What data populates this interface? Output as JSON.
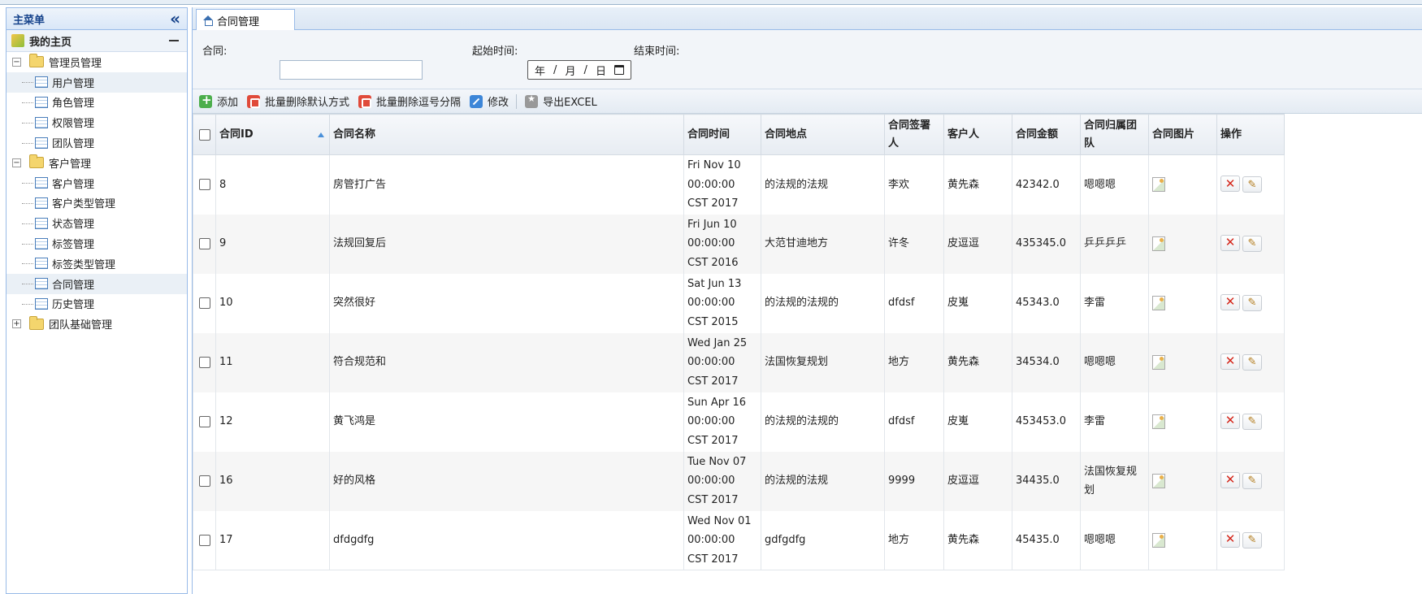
{
  "left_panel": {
    "title": "主菜单",
    "home_label": "我的主页",
    "tree": [
      {
        "label": "管理员管理",
        "expander": "−",
        "children": [
          "用户管理",
          "角色管理",
          "权限管理",
          "团队管理"
        ]
      },
      {
        "label": "客户管理",
        "expander": "−",
        "children": [
          "客户管理",
          "客户类型管理",
          "状态管理",
          "标签管理",
          "标签类型管理",
          "合同管理",
          "历史管理"
        ]
      },
      {
        "label": "团队基础管理",
        "expander": "+",
        "children": []
      }
    ]
  },
  "tab": {
    "label": "合同管理"
  },
  "search": {
    "contract_label": "合同:",
    "contract_value": "",
    "start_label": "起始时间:",
    "date_placeholder": {
      "year": "年",
      "month": "月",
      "day": "日"
    },
    "end_label": "结束时间:"
  },
  "toolbar": {
    "add": "添加",
    "batch_delete_default": "批量删除默认方式",
    "batch_delete_comma": "批量删除逗号分隔",
    "modify": "修改",
    "export": "导出EXCEL"
  },
  "grid": {
    "headers": [
      "合同ID",
      "合同名称",
      "合同时间",
      "合同地点",
      "合同签署人",
      "客户人",
      "合同金额",
      "合同归属团队",
      "合同图片",
      "操作"
    ],
    "rows": [
      {
        "id": "8",
        "name": "房管打广告",
        "time": "Fri Nov 10 00:00:00 CST 2017",
        "place": "的法规的法规",
        "signer": "李欢",
        "customer": "黄先森",
        "amount": "42342.0",
        "team": "嗯嗯嗯"
      },
      {
        "id": "9",
        "name": "法规回复后",
        "time": "Fri Jun 10 00:00:00 CST 2016",
        "place": "大范甘迪地方",
        "signer": "许冬",
        "customer": "皮逗逗",
        "amount": "435345.0",
        "team": "乒乒乒乒"
      },
      {
        "id": "10",
        "name": "突然很好",
        "time": "Sat Jun 13 00:00:00 CST 2015",
        "place": "的法规的法规的",
        "signer": "dfdsf",
        "customer": "皮嵬",
        "amount": "45343.0",
        "team": "李雷"
      },
      {
        "id": "11",
        "name": "符合规范和",
        "time": "Wed Jan 25 00:00:00 CST 2017",
        "place": "法国恢复规划",
        "signer": "地方",
        "customer": "黄先森",
        "amount": "34534.0",
        "team": "嗯嗯嗯"
      },
      {
        "id": "12",
        "name": "黄飞鸿是",
        "time": "Sun Apr 16 00:00:00 CST 2017",
        "place": "的法规的法规的",
        "signer": "dfdsf",
        "customer": "皮嵬",
        "amount": "453453.0",
        "team": "李雷"
      },
      {
        "id": "16",
        "name": "好的风格",
        "time": "Tue Nov 07 00:00:00 CST 2017",
        "place": "的法规的法规",
        "signer": "9999",
        "customer": "皮逗逗",
        "amount": "34435.0",
        "team": "法国恢复规划"
      },
      {
        "id": "17",
        "name": "dfdgdfg",
        "time": "Wed Nov 01 00:00:00 CST 2017",
        "place": "gdfgdfg",
        "signer": "地方",
        "customer": "黄先森",
        "amount": "45435.0",
        "team": "嗯嗯嗯"
      }
    ]
  },
  "colors": {
    "accent": "#15428b",
    "border": "#99bbe8",
    "delete_red": "#d4271b"
  }
}
